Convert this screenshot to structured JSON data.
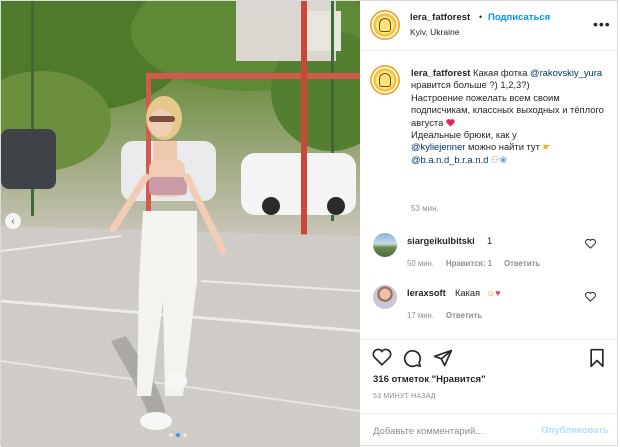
{
  "post": {
    "username": "lera_fatforest",
    "separator": "•",
    "follow_label": "Подписаться",
    "location": "Kyiv, Ukraine",
    "more_icon": "more-horizontal-icon"
  },
  "caption": {
    "username": "lera_fatforest",
    "text_1": "Какая фотка",
    "mention_1": "@rakovskiy_yura",
    "text_2": "нравится больше ?) 1,2,3?)",
    "text_3": "Настроение пожелать всем своим подписчикам, классных выходных и тёплого августа",
    "text_4": "Идеальные брюки, как у",
    "mention_2": "@kyliejenner",
    "text_5": "можно найти тут",
    "mention_3": "@b.a.n.d_b.r.a.n.d",
    "time": "53 мин."
  },
  "comments": [
    {
      "username": "siargeikulbitski",
      "text": "1",
      "time": "50 мин.",
      "likes": "Нравится: 1",
      "reply": "Ответить"
    },
    {
      "username": "leraxsoft",
      "text": "Какая",
      "time": "17 мин.",
      "reply": "Ответить"
    }
  ],
  "actions": {
    "like_icon": "heart-icon",
    "comment_icon": "comment-icon",
    "share_icon": "paper-plane-icon",
    "save_icon": "bookmark-icon"
  },
  "likes_text": "316 отметок \"Нравится\"",
  "posted_time": "53 МИНУТ НАЗАД",
  "comment_input": {
    "placeholder": "Добавьте комментарий..."
  },
  "publish_label": "Опубликовать",
  "carousel": {
    "count": 3,
    "active": 1
  },
  "colors": {
    "accent": "#0095f6",
    "link": "#00376b",
    "muted": "#8e8e8e",
    "heart": "#ed4956"
  }
}
